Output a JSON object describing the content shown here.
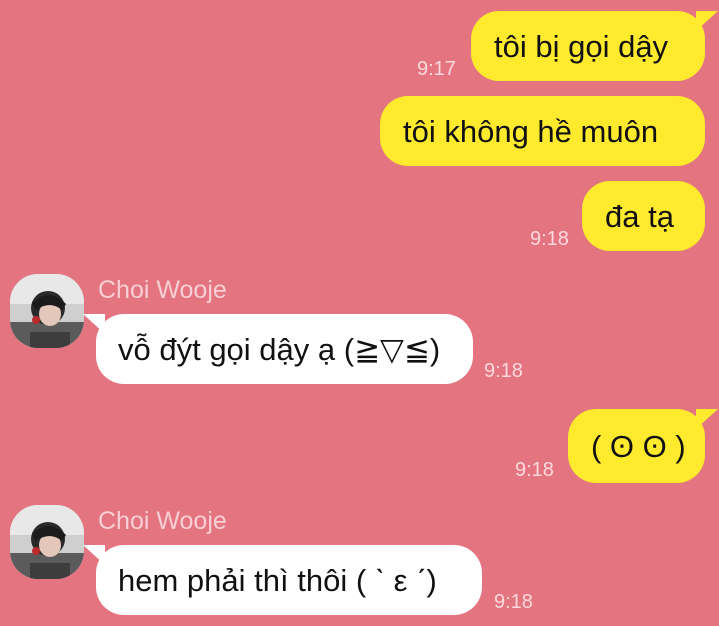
{
  "chat": {
    "messages": [
      {
        "from": "me",
        "text": "tôi bị gọi dậy",
        "time": "9:17"
      },
      {
        "from": "me",
        "text": "tôi không hề muôn",
        "time": ""
      },
      {
        "from": "me",
        "text": "đa tạ",
        "time": "9:18"
      },
      {
        "from": "them",
        "sender": "Choi Wooje",
        "text": "vỗ đýt gọi dậy ạ (≧▽≦)",
        "time": "9:18"
      },
      {
        "from": "me",
        "text": "( ʘ ʘ )",
        "time": "9:18"
      },
      {
        "from": "them",
        "sender": "Choi Wooje",
        "text": "hem phải thì thôi ( ˋ ε ˊ)",
        "time": "9:18"
      }
    ]
  },
  "colors": {
    "background": "#e4747f",
    "my_bubble": "#ffea2e",
    "their_bubble": "#ffffff",
    "timestamp": "#fbd9de",
    "sender_name": "#f8cfd5"
  },
  "icons": {
    "avatar": "user-avatar-photo"
  }
}
